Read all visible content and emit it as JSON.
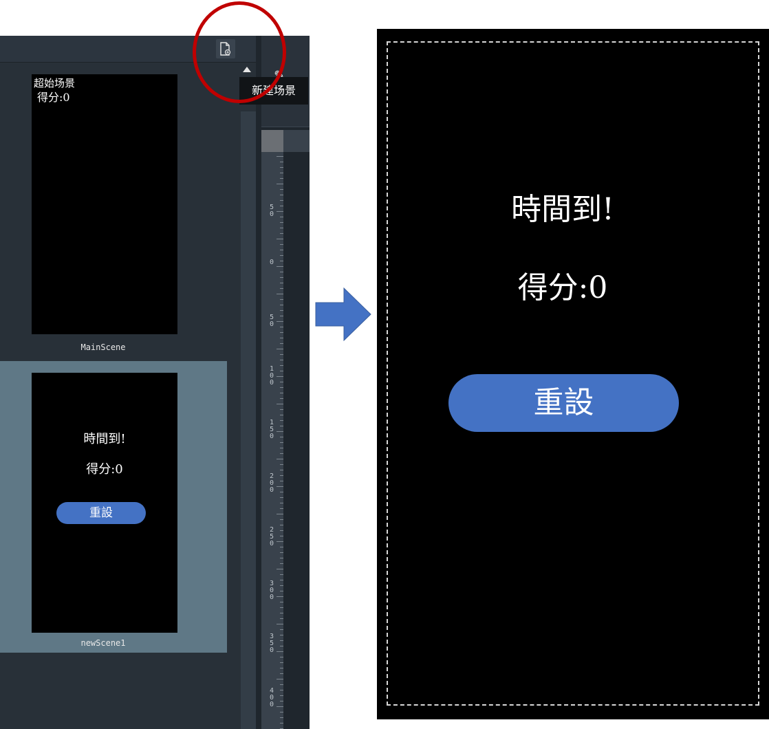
{
  "tooltip": "新建场景",
  "scenes": [
    {
      "name": "MainScene",
      "thumb_label_1": "超始场景",
      "thumb_label_2": "得分:0"
    },
    {
      "name": "newScene1",
      "title": "時間到!",
      "score": "得分:0",
      "button": "重設"
    }
  ],
  "ruler": {
    "labels": [
      "5\n0",
      "0",
      "5\n0",
      "1\n0\n0",
      "1\n5\n0",
      "2\n0\n0",
      "2\n5\n0",
      "3\n0\n0",
      "3\n5\n0",
      "4\n0\n0"
    ]
  },
  "preview": {
    "title": "時間到!",
    "score": "得分:0",
    "button": "重設"
  },
  "colors": {
    "button": "#4472c4",
    "highlight": "#c00000",
    "arrow": "#4472c4"
  },
  "icons": {
    "add_scene": "file-add-icon",
    "edit": "pencil-icon",
    "arrow": "right-arrow-icon"
  }
}
